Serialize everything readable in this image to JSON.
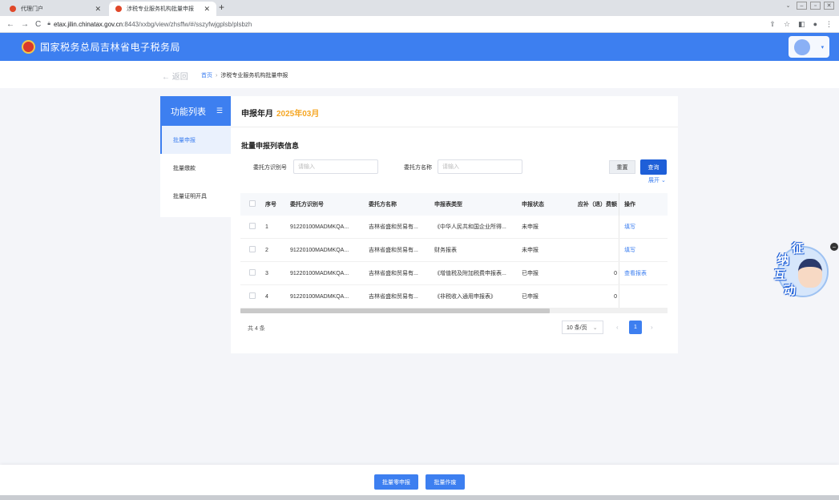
{
  "browser": {
    "tabs": [
      {
        "label": "代理门户",
        "active": false
      },
      {
        "label": "涉税专业服务机构批量申报",
        "active": true
      }
    ],
    "url_host": "etax.jilin.chinatax.gov.cn",
    "url_path": ":8443/xxbg/view/zhsffw/#/sszyfwjgplsb/plsbzh"
  },
  "header": {
    "title": "国家税务总局吉林省电子税务局",
    "brand_color": "#3d7ff0"
  },
  "breadcrumb": {
    "back_label": "← 返回",
    "home": "首页",
    "separator": "›",
    "current": "涉税专业服务机构批量申报"
  },
  "sidebar": {
    "title": "功能列表",
    "items": [
      {
        "label": "批量申报",
        "active": true
      },
      {
        "label": "批量缴款",
        "active": false
      },
      {
        "label": "批量证明开具",
        "active": false
      }
    ]
  },
  "main": {
    "period_label": "申报年月",
    "period_value": "2025年03月",
    "section_title": "批量申报列表信息",
    "filters": {
      "id_label": "委托方识别号",
      "id_placeholder": "请输入",
      "name_label": "委托方名称",
      "name_placeholder": "请输入"
    },
    "reset_label": "重置",
    "query_label": "查询",
    "expand_label": "展开 ⌄"
  },
  "table": {
    "headers": [
      "序号",
      "委托方识别号",
      "委托方名称",
      "申报表类型",
      "申报状态",
      "应补（退）费额",
      "操作"
    ],
    "rows": [
      {
        "idx": "1",
        "id": "91220100MADMKQA...",
        "name": "吉林省盛和贸易有...",
        "type": "《中华人民共和国企业所得...",
        "status": "未申报",
        "amount": "",
        "op": "填写"
      },
      {
        "idx": "2",
        "id": "91220100MADMKQA...",
        "name": "吉林省盛和贸易有...",
        "type": "财务报表",
        "status": "未申报",
        "amount": "",
        "op": "填写"
      },
      {
        "idx": "3",
        "id": "91220100MADMKQA...",
        "name": "吉林省盛和贸易有...",
        "type": "《增值税及附加税费申报表...",
        "status": "已申报",
        "amount": "0",
        "op": "查看报表"
      },
      {
        "idx": "4",
        "id": "91220100MADMKQA...",
        "name": "吉林省盛和贸易有...",
        "type": "《非税收入通用申报表》",
        "status": "已申报",
        "amount": "0",
        "op": ""
      }
    ]
  },
  "pagination": {
    "total": "共 4 条",
    "page_size": "10 条/页",
    "current_page": "1"
  },
  "widget": {
    "chars": [
      "征",
      "纳",
      "互",
      "动"
    ]
  },
  "footer": {
    "zero_declare_label": "批量零申报",
    "void_label": "批量作废"
  }
}
